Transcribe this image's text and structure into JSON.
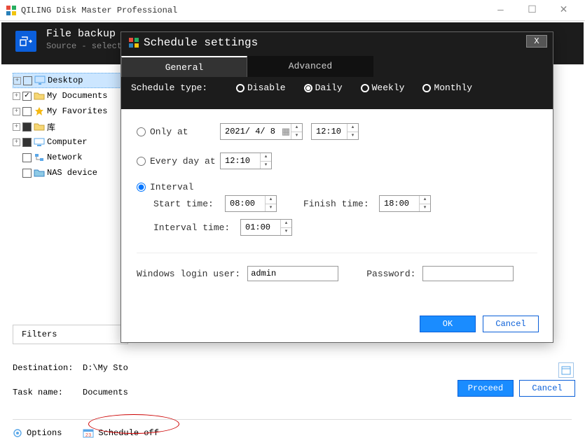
{
  "window": {
    "title": "QILING Disk Master Professional"
  },
  "header": {
    "title": "File backup",
    "subtitle": "Source - select"
  },
  "tree": {
    "items": [
      {
        "label": "Desktop"
      },
      {
        "label": "My Documents"
      },
      {
        "label": "My Favorites"
      },
      {
        "label": "库"
      },
      {
        "label": "Computer"
      },
      {
        "label": "Network"
      },
      {
        "label": "NAS device"
      }
    ]
  },
  "filters_label": "Filters",
  "destination": {
    "label": "Destination:",
    "value": "D:\\My Sto"
  },
  "task": {
    "label": "Task name:",
    "value": "Documents"
  },
  "options_label": "Options",
  "schedule_off_label": "Schedule off",
  "footer": {
    "proceed": "Proceed",
    "cancel": "Cancel"
  },
  "modal": {
    "title": "Schedule settings",
    "tabs": {
      "general": "General",
      "advanced": "Advanced"
    },
    "schedule_type_label": "Schedule type:",
    "types": {
      "disable": "Disable",
      "daily": "Daily",
      "weekly": "Weekly",
      "monthly": "Monthly"
    },
    "only_at": {
      "label": "Only at",
      "date": "2021/ 4/ 8",
      "time": "12:10"
    },
    "every_day": {
      "label": "Every day at",
      "time": "12:10"
    },
    "interval": {
      "label": "Interval",
      "start_label": "Start time:",
      "start": "08:00",
      "finish_label": "Finish time:",
      "finish": "18:00",
      "interval_label": "Interval time:",
      "interval": "01:00"
    },
    "cred": {
      "user_label": "Windows login user:",
      "user": "admin",
      "pass_label": "Password:"
    },
    "ok": "OK",
    "cancel": "Cancel"
  }
}
